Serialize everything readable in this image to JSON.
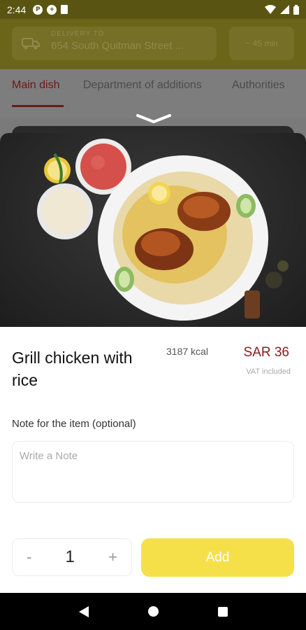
{
  "status_bar": {
    "time": "2:44",
    "icons": [
      "p-icon",
      "plus-icon",
      "sd-card-icon"
    ],
    "right_icons": [
      "wifi-icon",
      "signal-icon",
      "battery-icon"
    ]
  },
  "header": {
    "delivery_label": "DELIVERY TO",
    "delivery_address": "654 South Quitman Street ...",
    "time_estimate": "~ 45 min",
    "brand_color": "#f6e04a"
  },
  "tabs": [
    {
      "label": "Main dish",
      "active": true
    },
    {
      "label": "Department of additions",
      "active": false
    },
    {
      "label": "Authorities",
      "active": false
    }
  ],
  "item": {
    "name": "Grill chicken with rice",
    "kcal": "3187 kcal",
    "price": "SAR 36",
    "vat_note": "VAT included",
    "price_color": "#8b1a1a"
  },
  "note": {
    "label": "Note for the item (optional)",
    "placeholder": "Write a Note",
    "value": ""
  },
  "quantity": {
    "decrement_label": "-",
    "value": "1",
    "increment_label": "+"
  },
  "add_button": {
    "label": "Add",
    "color": "#f6e04a"
  },
  "nav_bar": {
    "icons": [
      "back-icon",
      "home-icon",
      "recents-icon"
    ]
  }
}
